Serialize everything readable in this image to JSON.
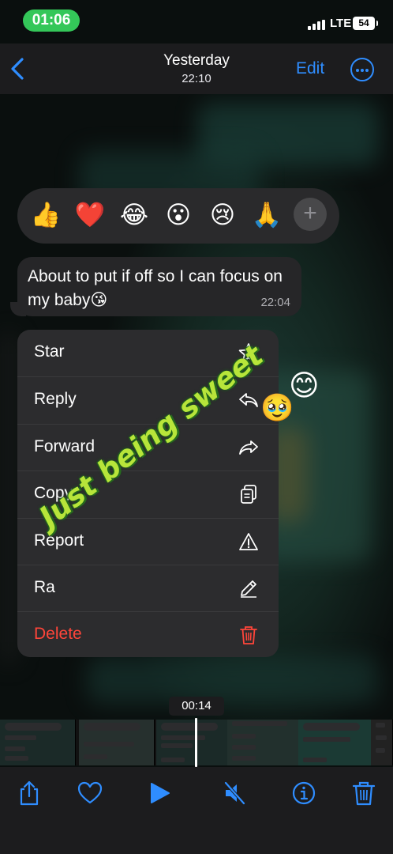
{
  "status_bar": {
    "time": "01:06",
    "network": "LTE",
    "battery": "54"
  },
  "nav": {
    "title": "Yesterday",
    "subtitle": "22:10",
    "edit_label": "Edit"
  },
  "reactions": [
    "👍",
    "❤️",
    "😂",
    "😮",
    "😢",
    "🙏"
  ],
  "message": {
    "text": "About to put if off so I can focus on my baby😘",
    "time": "22:04"
  },
  "menu": {
    "items": [
      {
        "label": "Star",
        "icon": "star-icon"
      },
      {
        "label": "Reply",
        "icon": "reply-icon"
      },
      {
        "label": "Forward",
        "icon": "forward-icon"
      },
      {
        "label": "Copy",
        "icon": "copy-icon"
      },
      {
        "label": "Report",
        "icon": "warning-icon"
      },
      {
        "label": "Ra",
        "icon": "pencil-icon"
      },
      {
        "label": "Delete",
        "icon": "trash-icon"
      }
    ]
  },
  "sticker": {
    "text": "Just being sweet",
    "emoji_1": "😊",
    "emoji_2": "🥹"
  },
  "video": {
    "timestamp": "00:14"
  },
  "colors": {
    "accent": "#2f8dff",
    "danger": "#ff453a",
    "status_green": "#34c759",
    "sticker_text": "#b7e53a"
  }
}
